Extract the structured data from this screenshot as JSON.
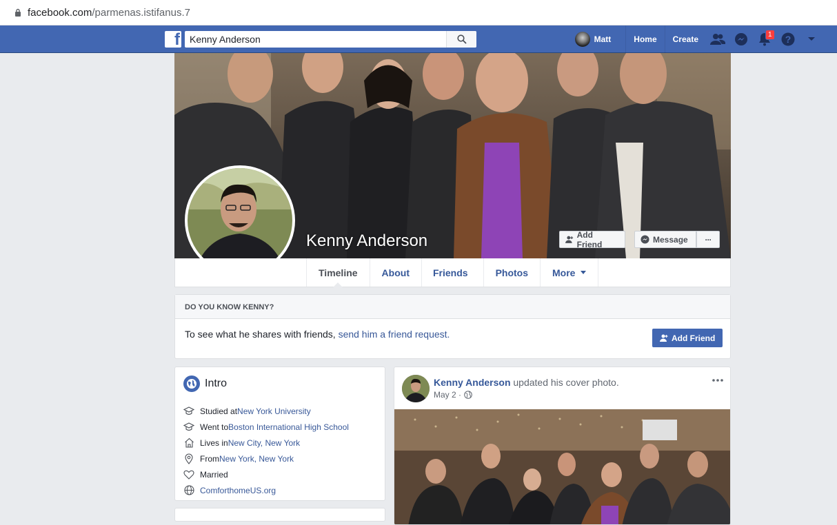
{
  "browser": {
    "url_domain": "facebook.com",
    "url_path": "/parmenas.istifanus.7"
  },
  "topnav": {
    "search_value": "Kenny Anderson",
    "user_name": "Matt",
    "home_label": "Home",
    "create_label": "Create",
    "notification_count": "1",
    "brand_color": "#4267b2"
  },
  "profile": {
    "name": "Kenny Anderson",
    "add_friend_label": "Add Friend",
    "message_label": "Message",
    "more_dots_label": "···"
  },
  "tabs": [
    {
      "label": "Timeline",
      "active": true
    },
    {
      "label": "About"
    },
    {
      "label": "Friends"
    },
    {
      "label": "Photos"
    },
    {
      "label": "More"
    }
  ],
  "know_box": {
    "heading": "DO YOU KNOW KENNY?",
    "text_prefix": "To see what he shares with friends, ",
    "link_text": "send him a friend request.",
    "button_label": "Add Friend"
  },
  "intro": {
    "title": "Intro",
    "items": [
      {
        "icon": "graduation-cap-icon",
        "prefix": "Studied at ",
        "link": "New York University"
      },
      {
        "icon": "graduation-cap-icon",
        "prefix": "Went to ",
        "link": "Boston International High School"
      },
      {
        "icon": "home-icon",
        "prefix": "Lives in ",
        "link": "New City, New York"
      },
      {
        "icon": "location-pin-icon",
        "prefix": "From ",
        "link": "New York, New York"
      },
      {
        "icon": "heart-icon",
        "prefix": "Married",
        "link": ""
      },
      {
        "icon": "globe-icon",
        "prefix": "",
        "link": "ComforthomeUS.org"
      }
    ]
  },
  "post": {
    "author": "Kenny Anderson",
    "action": " updated his cover photo.",
    "date": "May 2 ·"
  }
}
